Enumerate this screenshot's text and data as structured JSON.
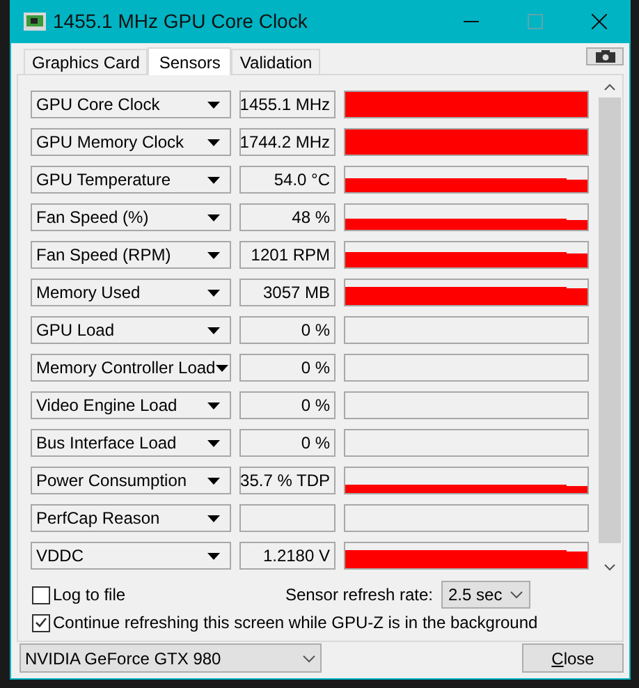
{
  "window": {
    "title": "1455.1 MHz GPU Core Clock"
  },
  "tabs": [
    {
      "label": "Graphics Card",
      "selected": false
    },
    {
      "label": "Sensors",
      "selected": true
    },
    {
      "label": "Validation",
      "selected": false
    }
  ],
  "sensors": [
    {
      "name": "GPU Core Clock",
      "value": "1455.1 MHz"
    },
    {
      "name": "GPU Memory Clock",
      "value": "1744.2 MHz"
    },
    {
      "name": "GPU Temperature",
      "value": "54.0 °C"
    },
    {
      "name": "Fan Speed (%)",
      "value": "48 %"
    },
    {
      "name": "Fan Speed (RPM)",
      "value": "1201 RPM"
    },
    {
      "name": "Memory Used",
      "value": "3057 MB"
    },
    {
      "name": "GPU Load",
      "value": "0 %"
    },
    {
      "name": "Memory Controller Load",
      "value": "0 %"
    },
    {
      "name": "Video Engine Load",
      "value": "0 %"
    },
    {
      "name": "Bus Interface Load",
      "value": "0 %"
    },
    {
      "name": "Power Consumption",
      "value": "35.7 % TDP"
    },
    {
      "name": "PerfCap Reason"
    },
    {
      "name": "VDDC",
      "value": "1.2180 V"
    }
  ],
  "log_to_file": {
    "label": "Log to file",
    "checked": false
  },
  "refresh_rate": {
    "label": "Sensor refresh rate:",
    "value": "2.5 sec"
  },
  "background_refresh": {
    "label": "Continue refreshing this screen while GPU-Z is in the background",
    "checked": true
  },
  "gpu_select": {
    "value": "NVIDIA GeForce GTX 980"
  },
  "close_button": {
    "label": "Close"
  }
}
